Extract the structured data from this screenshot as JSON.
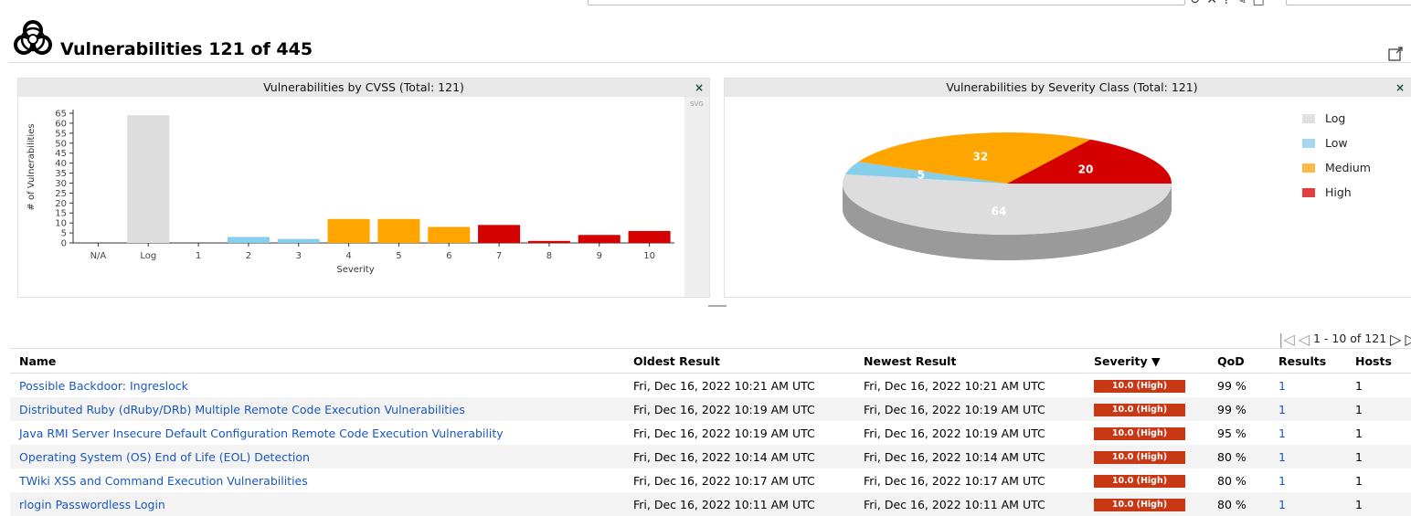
{
  "page": {
    "title": "Vulnerabilities 121 of 445"
  },
  "cvss_panel": {
    "title": "Vulnerabilities by CVSS (Total: 121)",
    "close": "×",
    "svg_button": "SVG"
  },
  "severity_panel": {
    "title": "Vulnerabilities by Severity Class (Total: 121)",
    "close": "×",
    "legend": [
      {
        "label": "Log",
        "color": "#e0e0e0"
      },
      {
        "label": "Low",
        "color": "#a6d7f0"
      },
      {
        "label": "Medium",
        "color": "#f9bb43"
      },
      {
        "label": "High",
        "color": "#e43d3d"
      }
    ]
  },
  "chart_data": [
    {
      "type": "bar",
      "title": "Vulnerabilities by CVSS (Total: 121)",
      "xlabel": "Severity",
      "ylabel": "# of Vulnerabilities",
      "ylim": [
        0,
        65
      ],
      "yticks": [
        0,
        5,
        10,
        15,
        20,
        25,
        30,
        35,
        40,
        45,
        50,
        55,
        60,
        65
      ],
      "categories": [
        "N/A",
        "Log",
        "1",
        "2",
        "3",
        "4",
        "5",
        "6",
        "7",
        "8",
        "9",
        "10"
      ],
      "values": [
        0,
        64,
        0,
        3,
        2,
        12,
        12,
        8,
        9,
        1,
        4,
        6
      ],
      "colors": [
        "#dddddd",
        "#dddddd",
        "#87ceeb",
        "#87ceeb",
        "#87ceeb",
        "#ffa500",
        "#ffa500",
        "#ffa500",
        "#d50000",
        "#d50000",
        "#d50000",
        "#d50000"
      ],
      "grid": false
    },
    {
      "type": "pie",
      "title": "Vulnerabilities by Severity Class (Total: 121)",
      "slices": [
        {
          "label": "Log",
          "value": 64,
          "color": "#dddddd",
          "side": "#9a9a9a"
        },
        {
          "label": "Low",
          "value": 5,
          "color": "#87ceeb",
          "side": "#5fa8c8"
        },
        {
          "label": "Medium",
          "value": 32,
          "color": "#ffa500",
          "side": "#c07a00"
        },
        {
          "label": "High",
          "value": 20,
          "color": "#d50000",
          "side": "#8f0000"
        }
      ],
      "legend": "right"
    }
  ],
  "pager": {
    "text": "1 - 10 of 121"
  },
  "table": {
    "headers": {
      "name": "Name",
      "oldest": "Oldest Result",
      "newest": "Newest Result",
      "severity": "Severity ▼",
      "qod": "QoD",
      "results": "Results",
      "hosts": "Hosts"
    },
    "rows": [
      {
        "name": "Possible Backdoor: Ingreslock",
        "oldest": "Fri, Dec 16, 2022 10:21 AM UTC",
        "newest": "Fri, Dec 16, 2022 10:21 AM UTC",
        "severity": "10.0 (High)",
        "severity_value": 10.0,
        "qod": "99 %",
        "results": "1",
        "hosts": "1"
      },
      {
        "name": "Distributed Ruby (dRuby/DRb) Multiple Remote Code Execution Vulnerabilities",
        "oldest": "Fri, Dec 16, 2022 10:19 AM UTC",
        "newest": "Fri, Dec 16, 2022 10:19 AM UTC",
        "severity": "10.0 (High)",
        "severity_value": 10.0,
        "qod": "99 %",
        "results": "1",
        "hosts": "1"
      },
      {
        "name": "Java RMI Server Insecure Default Configuration Remote Code Execution Vulnerability",
        "oldest": "Fri, Dec 16, 2022 10:19 AM UTC",
        "newest": "Fri, Dec 16, 2022 10:19 AM UTC",
        "severity": "10.0 (High)",
        "severity_value": 10.0,
        "qod": "95 %",
        "results": "1",
        "hosts": "1"
      },
      {
        "name": "Operating System (OS) End of Life (EOL) Detection",
        "oldest": "Fri, Dec 16, 2022 10:14 AM UTC",
        "newest": "Fri, Dec 16, 2022 10:14 AM UTC",
        "severity": "10.0 (High)",
        "severity_value": 10.0,
        "qod": "80 %",
        "results": "1",
        "hosts": "1"
      },
      {
        "name": "TWiki XSS and Command Execution Vulnerabilities",
        "oldest": "Fri, Dec 16, 2022 10:17 AM UTC",
        "newest": "Fri, Dec 16, 2022 10:17 AM UTC",
        "severity": "10.0 (High)",
        "severity_value": 10.0,
        "qod": "80 %",
        "results": "1",
        "hosts": "1"
      },
      {
        "name": "rlogin Passwordless Login",
        "oldest": "Fri, Dec 16, 2022 10:11 AM UTC",
        "newest": "Fri, Dec 16, 2022 10:11 AM UTC",
        "severity": "10.0 (High)",
        "severity_value": 10.0,
        "qod": "80 %",
        "results": "1",
        "hosts": "1"
      }
    ]
  },
  "icons": {
    "page": "biohazard-icon",
    "new_window": "new-tab-icon",
    "pager_first": "first-page-icon",
    "pager_prev": "prev-page-icon",
    "pager_next": "next-page-icon",
    "pager_last": "last-page-icon"
  }
}
